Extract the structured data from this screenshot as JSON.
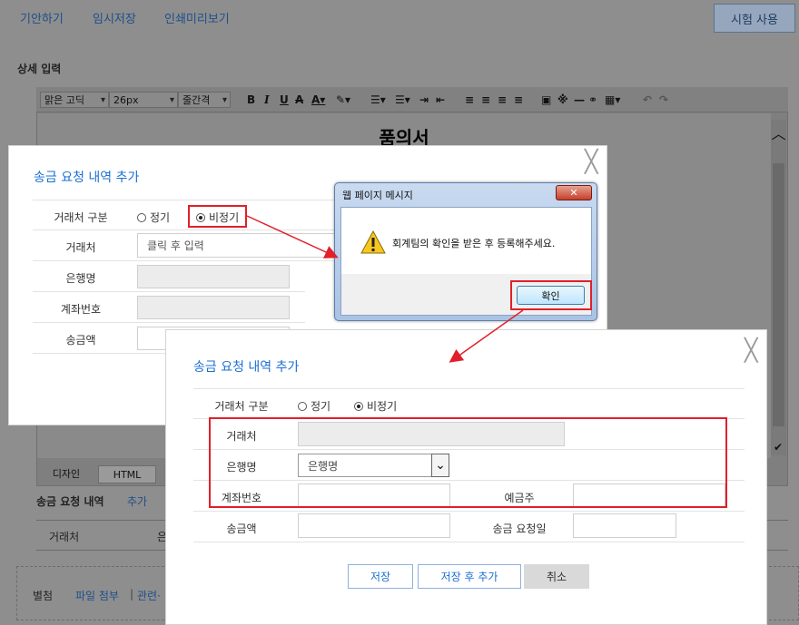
{
  "top_nav": {
    "draft": "기안하기",
    "temp_save": "임시저장",
    "print_preview": "인쇄미리보기",
    "trial": "시험 사용"
  },
  "editor": {
    "section_label": "상세 입력",
    "font_family": "맑은 고딕",
    "font_size": "26px",
    "line_spacing": "줄간격",
    "doc_title": "품의서",
    "tabs": {
      "design": "디자인",
      "html": "HTML"
    }
  },
  "send_section": {
    "title": "송금 요청 내역",
    "add_link": "추가",
    "col_vendor": "거래처",
    "col_cut": "은"
  },
  "attachments": {
    "label": "별첨",
    "file_link": "파일 첨부",
    "related_link": "관련·"
  },
  "modal1": {
    "title": "송금 요청 내역 추가",
    "vendor_type_label": "거래처 구분",
    "regular": "정기",
    "irregular": "비정기",
    "vendor_label": "거래처",
    "vendor_placeholder": "클릭 후 입력",
    "bank_label": "은행명",
    "account_label": "계좌번호",
    "amount_label": "송금액"
  },
  "dialog": {
    "title": "웹 페이지 메시지",
    "message": "회계팀의 확인을 받은 후 등록해주세요.",
    "ok": "확인"
  },
  "modal2": {
    "title": "송금 요청 내역 추가",
    "vendor_type_label": "거래처 구분",
    "regular": "정기",
    "irregular": "비정기",
    "vendor_label": "거래처",
    "bank_label": "은행명",
    "bank_value": "은행명",
    "account_label": "계좌번호",
    "holder_label": "예금주",
    "amount_label": "송금액",
    "request_date_label": "송금 요청일",
    "btn_save": "저장",
    "btn_save_add": "저장 후 추가",
    "btn_cancel": "취소"
  },
  "colors": {
    "accent_blue": "#1a6fd0",
    "annotation_red": "#e0202a"
  }
}
